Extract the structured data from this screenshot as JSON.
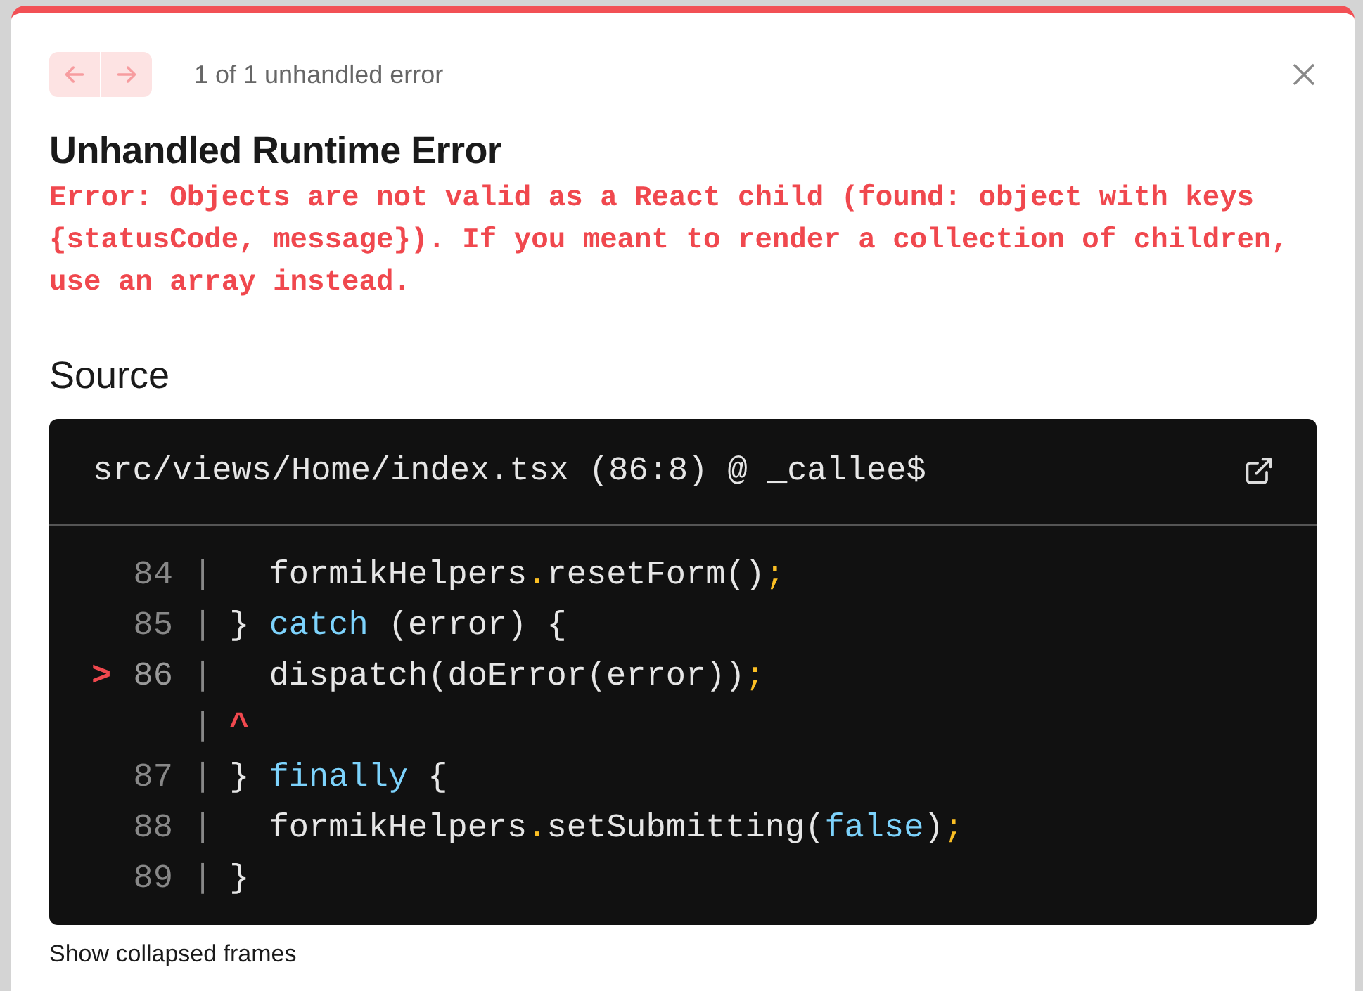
{
  "nav": {
    "buttons": [
      {
        "kind": "prev",
        "disabled": true
      },
      {
        "kind": "next",
        "disabled": true
      }
    ],
    "counter": "1 of 1 unhandled error"
  },
  "title": "Unhandled Runtime Error",
  "message": "Error: Objects are not valid as a React child (found: object with keys {statusCode, message}). If you meant to render a collection of children, use an array instead.",
  "source_heading": "Source",
  "source": {
    "file": "src/views/Home/index.tsx (86:8) @ _callee$",
    "lines": [
      {
        "kind": "code",
        "highlighted": false,
        "number": "84",
        "gutter": "|",
        "segments": [
          {
            "kind": "plain",
            "text": "  formikHelpers"
          },
          {
            "kind": "punct",
            "text": "."
          },
          {
            "kind": "plain",
            "text": "resetForm()"
          },
          {
            "kind": "punct",
            "text": ";"
          }
        ]
      },
      {
        "kind": "code",
        "highlighted": false,
        "number": "85",
        "gutter": "|",
        "segments": [
          {
            "kind": "plain",
            "text": "} "
          },
          {
            "kind": "keyword",
            "text": "catch"
          },
          {
            "kind": "plain",
            "text": " (error) {"
          }
        ]
      },
      {
        "kind": "code",
        "highlighted": true,
        "marker": ">",
        "number": "86",
        "gutter": "|",
        "segments": [
          {
            "kind": "plain",
            "text": "  dispatch(doError(error))"
          },
          {
            "kind": "punct",
            "text": ";"
          }
        ]
      },
      {
        "kind": "caret",
        "gutter": "|",
        "text": "^"
      },
      {
        "kind": "code",
        "highlighted": false,
        "number": "87",
        "gutter": "|",
        "segments": [
          {
            "kind": "plain",
            "text": "} "
          },
          {
            "kind": "keyword",
            "text": "finally"
          },
          {
            "kind": "plain",
            "text": " {"
          }
        ]
      },
      {
        "kind": "code",
        "highlighted": false,
        "number": "88",
        "gutter": "|",
        "segments": [
          {
            "kind": "plain",
            "text": "  formikHelpers"
          },
          {
            "kind": "punct",
            "text": "."
          },
          {
            "kind": "plain",
            "text": "setSubmitting("
          },
          {
            "kind": "keyword",
            "text": "false"
          },
          {
            "kind": "plain",
            "text": ")"
          },
          {
            "kind": "punct",
            "text": ";"
          }
        ]
      },
      {
        "kind": "code",
        "highlighted": false,
        "number": "89",
        "gutter": "|",
        "segments": [
          {
            "kind": "plain",
            "text": "}"
          }
        ]
      }
    ]
  },
  "footer_link": "Show collapsed frames"
}
